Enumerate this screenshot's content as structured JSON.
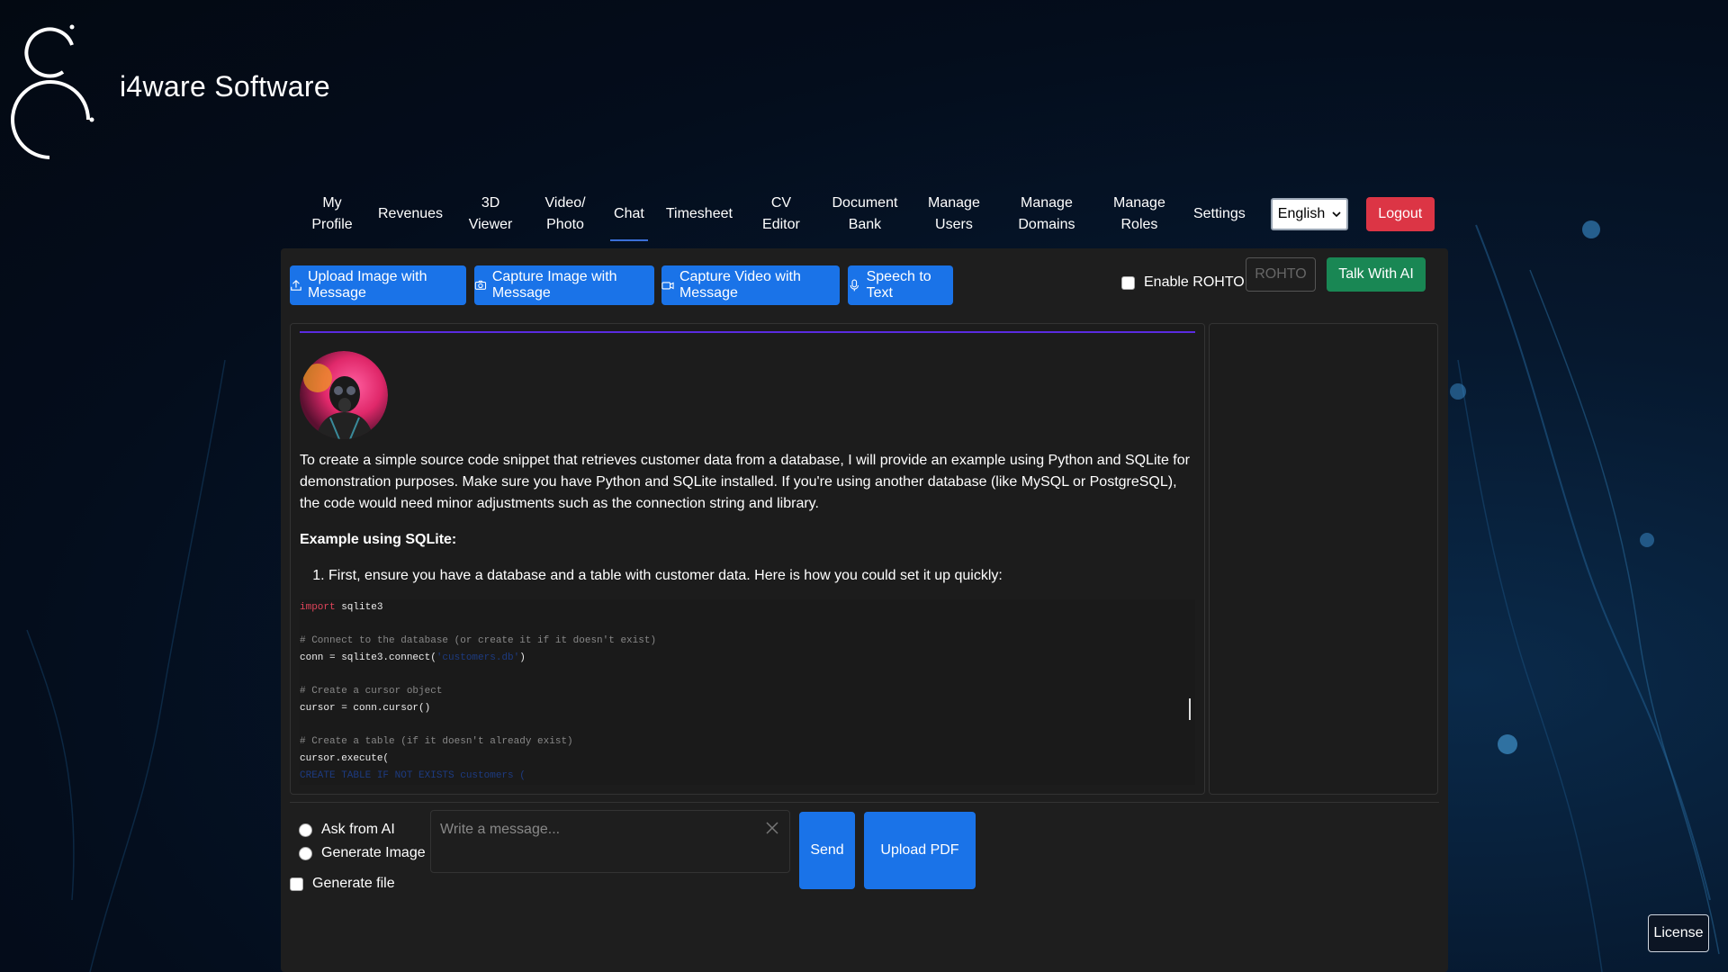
{
  "brand": {
    "name": "i4ware Software"
  },
  "nav": {
    "items": [
      {
        "label": "My\nProfile",
        "active": false
      },
      {
        "label": "Revenues",
        "active": false
      },
      {
        "label": "3D\nViewer",
        "active": false
      },
      {
        "label": "Video/\nPhoto",
        "active": false
      },
      {
        "label": "Chat",
        "active": true
      },
      {
        "label": "Timesheet",
        "active": false
      },
      {
        "label": "CV\nEditor",
        "active": false
      },
      {
        "label": "Document\nBank",
        "active": false
      },
      {
        "label": "Manage\nUsers",
        "active": false
      },
      {
        "label": "Manage\nDomains",
        "active": false
      },
      {
        "label": "Manage\nRoles",
        "active": false
      },
      {
        "label": "Settings",
        "active": false
      }
    ],
    "language": "English",
    "logout": "Logout"
  },
  "toolbar": {
    "upload_image": "Upload Image with Message",
    "capture_image": "Capture Image with Message",
    "capture_video": "Capture Video with Message",
    "speech_to_text": "Speech to Text",
    "enable_rohto": "Enable ROHTO",
    "rohto_placeholder": "ROHTO",
    "talk_with_ai": "Talk With AI"
  },
  "chat": {
    "intro": "To create a simple source code snippet that retrieves customer data from a database, I will provide an example using Python and SQLite for demonstration purposes. Make sure you have Python and SQLite installed. If you're using another database (like MySQL or PostgreSQL), the code would need minor adjustments such as the connection string and library.",
    "heading": "Example using SQLite:",
    "step1": "First, ensure you have a database and a table with customer data. Here is how you could set it up quickly:",
    "code": {
      "l1_kw": "import",
      "l1_rest": " sqlite3",
      "l2": "# Connect to the database (or create it if it doesn't exist)",
      "l3_a": "conn = sqlite3.connect(",
      "l3_str": "'customers.db'",
      "l3_b": ")",
      "l4": "# Create a cursor object",
      "l5": "cursor = conn.cursor()",
      "l6": "# Create a table (if it doesn't already exist)",
      "l7": "cursor.execute(",
      "l8": "CREATE TABLE IF NOT EXISTS customers ("
    }
  },
  "composer": {
    "ask_ai": "Ask from AI",
    "generate_image": "Generate Image",
    "generate_file": "Generate file",
    "placeholder": "Write a message...",
    "send": "Send",
    "upload_pdf": "Upload PDF"
  },
  "footer": {
    "license": "License"
  },
  "colors": {
    "primary": "#1a73e8",
    "danger": "#dc3545",
    "success": "#198754",
    "panel": "#1e1e1e"
  }
}
